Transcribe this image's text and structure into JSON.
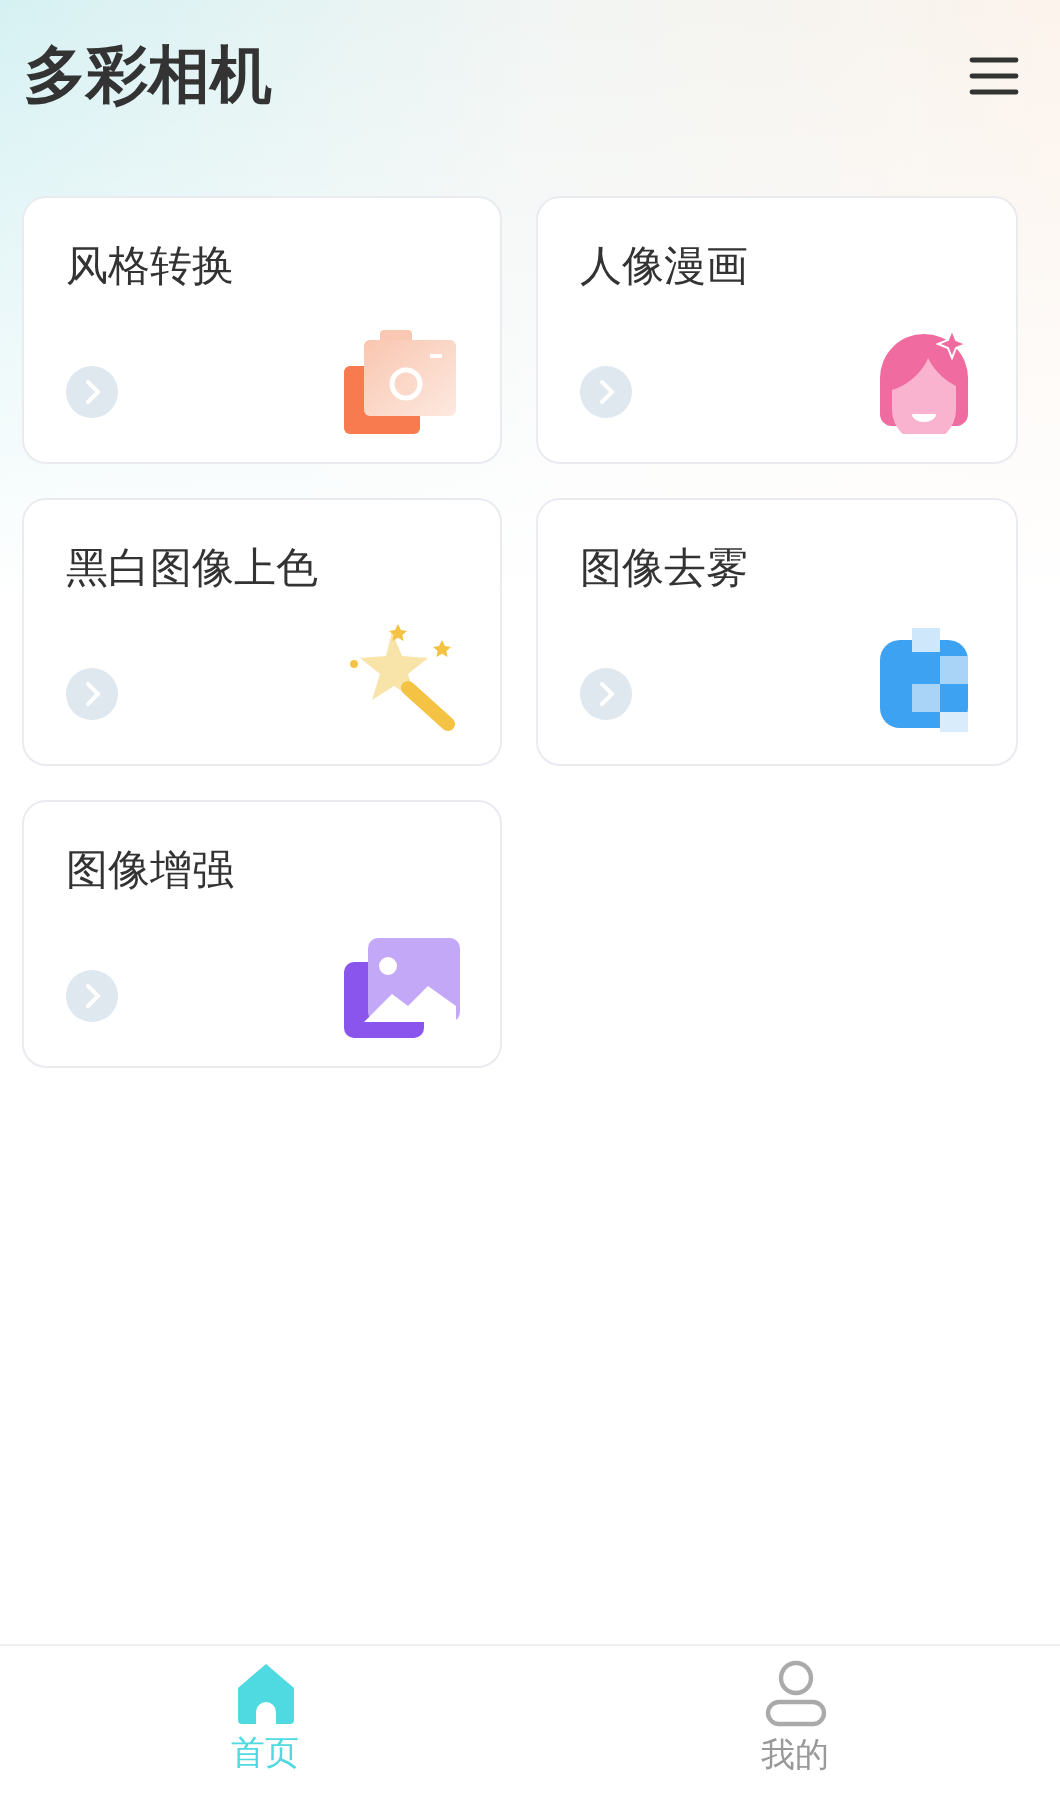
{
  "app_title": "多彩相机",
  "cards": [
    {
      "label": "风格转换",
      "kind": "camera"
    },
    {
      "label": "人像漫画",
      "kind": "portrait"
    },
    {
      "label": "黑白图像上色",
      "kind": "wand"
    },
    {
      "label": "图像去雾",
      "kind": "dehaze"
    },
    {
      "label": "图像增强",
      "kind": "enhance"
    }
  ],
  "tabs": [
    {
      "label": "首页",
      "kind": "home",
      "selected": true
    },
    {
      "label": "我的",
      "kind": "user",
      "selected": false
    }
  ]
}
